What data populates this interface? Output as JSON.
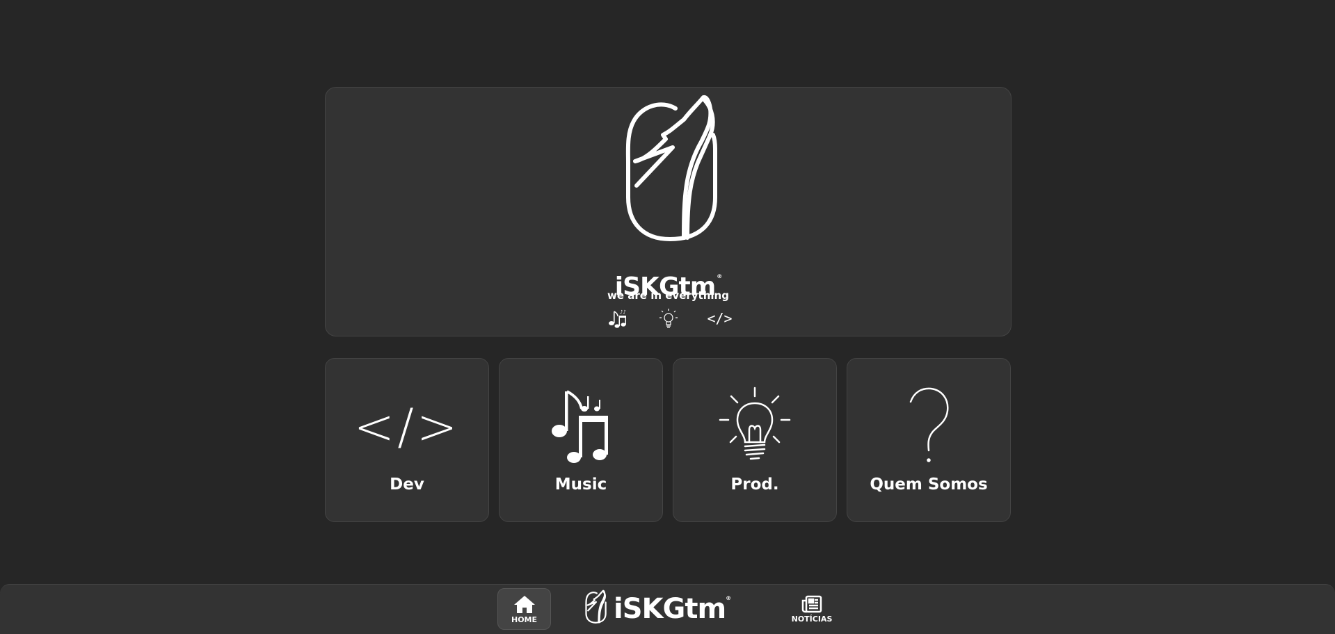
{
  "hero": {
    "brand": "iSKGtm",
    "registered": "®",
    "tagline": "we are in everything",
    "icons": [
      "music-notes-icon",
      "lightbulb-icon",
      "code-icon"
    ],
    "code_glyph": "</>"
  },
  "cards": [
    {
      "label": "Dev",
      "icon": "code-icon",
      "glyph": "</>"
    },
    {
      "label": "Music",
      "icon": "music-notes-icon"
    },
    {
      "label": "Prod.",
      "icon": "lightbulb-icon"
    },
    {
      "label": "Quem Somos",
      "icon": "question-mark-icon",
      "glyph": "?"
    }
  ],
  "nav": {
    "home_label": "HOME",
    "brand": "iSKGtm",
    "registered": "®",
    "news_label": "NOTÍCIAS"
  },
  "colors": {
    "background": "#262626",
    "panel": "#333333",
    "border": "#444444",
    "foreground": "#ffffff"
  }
}
